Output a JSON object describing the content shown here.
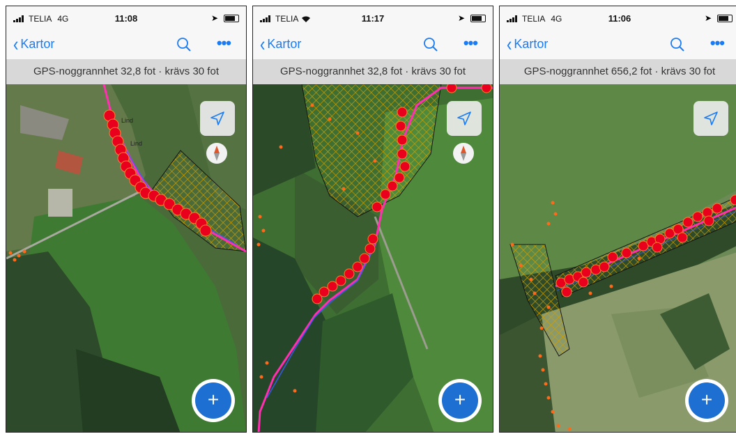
{
  "screens": [
    {
      "carrier": "TELIA",
      "network": "4G",
      "time": "11:08",
      "back_label": "Kartor",
      "gps_banner": "GPS-noggrannhet 32,8 fot · krävs 30 fot",
      "has_compass": true,
      "map_labels": [
        "Lind",
        "Lind"
      ]
    },
    {
      "carrier": "TELIA",
      "network": "",
      "time": "11:17",
      "back_label": "Kartor",
      "gps_banner": "GPS-noggrannhet 32,8 fot · krävs 30 fot",
      "has_compass": true,
      "map_labels": []
    },
    {
      "carrier": "TELIA",
      "network": "4G",
      "time": "11:06",
      "back_label": "Kartor",
      "gps_banner": "GPS-noggrannhet 656,2 fot · krävs 30 fot",
      "has_compass": false,
      "map_labels": []
    }
  ],
  "icons": {
    "back": "chevron-left-icon",
    "search": "search-icon",
    "more": "more-icon",
    "locate": "location-arrow-icon",
    "compass": "compass-icon",
    "add": "plus-icon"
  },
  "colors": {
    "accent": "#1a7cf5",
    "fab": "#1d6fd1",
    "track": "#ff2fb0",
    "track_points": "#e8001c",
    "area_hatch": "#d4a000",
    "banner_bg": "#d8d8d8"
  },
  "more_glyph": "•••",
  "add_glyph": "+"
}
